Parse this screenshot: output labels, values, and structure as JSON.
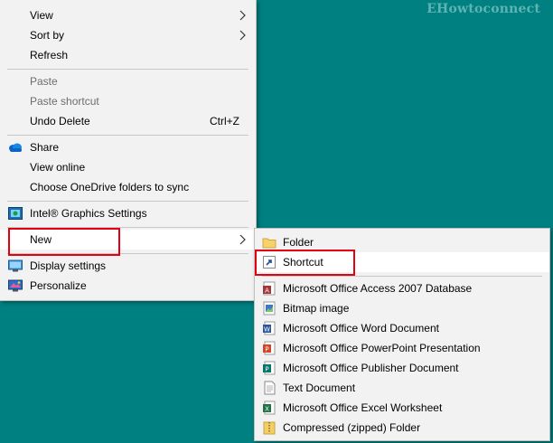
{
  "watermark": "EHowtoconnect",
  "context_menu": {
    "view": "View",
    "sort_by": "Sort by",
    "refresh": "Refresh",
    "paste": "Paste",
    "paste_shortcut": "Paste shortcut",
    "undo_delete": "Undo Delete",
    "undo_shortcut": "Ctrl+Z",
    "share": "Share",
    "view_online": "View online",
    "choose_onedrive": "Choose OneDrive folders to sync",
    "intel_graphics": "Intel® Graphics Settings",
    "new": "New",
    "display_settings": "Display settings",
    "personalize": "Personalize"
  },
  "new_submenu": {
    "folder": "Folder",
    "shortcut": "Shortcut",
    "access": "Microsoft Office Access 2007 Database",
    "bitmap": "Bitmap image",
    "word": "Microsoft Office Word Document",
    "powerpoint": "Microsoft Office PowerPoint Presentation",
    "publisher": "Microsoft Office Publisher Document",
    "text": "Text Document",
    "excel": "Microsoft Office Excel Worksheet",
    "zip": "Compressed (zipped) Folder"
  },
  "colors": {
    "desktop": "#008080",
    "menu_bg": "#f2f2f2",
    "highlight": "#e3000f"
  }
}
